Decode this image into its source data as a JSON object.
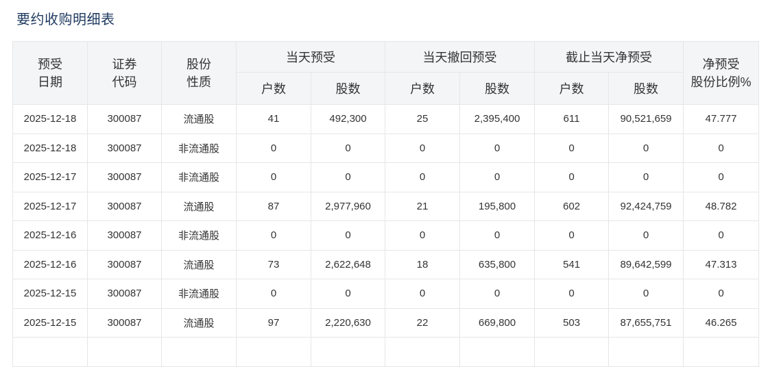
{
  "page": {
    "title": "要约收购明细表"
  },
  "table": {
    "headers": {
      "date": "预受\n日期",
      "code": "证券\n代码",
      "nature": "股份\n性质",
      "group_today": "当天预受",
      "group_withdraw": "当天撤回预受",
      "group_net": "截止当天净预受",
      "ratio": "净预受\n股份比例%",
      "households": "户数",
      "shares": "股数"
    },
    "rows": [
      {
        "date": "2025-12-18",
        "code": "300087",
        "nature": "流通股",
        "today_hh": "41",
        "today_shares": "492,300",
        "wd_hh": "25",
        "wd_shares": "2,395,400",
        "net_hh": "611",
        "net_shares": "90,521,659",
        "ratio": "47.777"
      },
      {
        "date": "2025-12-18",
        "code": "300087",
        "nature": "非流通股",
        "today_hh": "0",
        "today_shares": "0",
        "wd_hh": "0",
        "wd_shares": "0",
        "net_hh": "0",
        "net_shares": "0",
        "ratio": "0"
      },
      {
        "date": "2025-12-17",
        "code": "300087",
        "nature": "非流通股",
        "today_hh": "0",
        "today_shares": "0",
        "wd_hh": "0",
        "wd_shares": "0",
        "net_hh": "0",
        "net_shares": "0",
        "ratio": "0"
      },
      {
        "date": "2025-12-17",
        "code": "300087",
        "nature": "流通股",
        "today_hh": "87",
        "today_shares": "2,977,960",
        "wd_hh": "21",
        "wd_shares": "195,800",
        "net_hh": "602",
        "net_shares": "92,424,759",
        "ratio": "48.782"
      },
      {
        "date": "2025-12-16",
        "code": "300087",
        "nature": "非流通股",
        "today_hh": "0",
        "today_shares": "0",
        "wd_hh": "0",
        "wd_shares": "0",
        "net_hh": "0",
        "net_shares": "0",
        "ratio": "0"
      },
      {
        "date": "2025-12-16",
        "code": "300087",
        "nature": "流通股",
        "today_hh": "73",
        "today_shares": "2,622,648",
        "wd_hh": "18",
        "wd_shares": "635,800",
        "net_hh": "541",
        "net_shares": "89,642,599",
        "ratio": "47.313"
      },
      {
        "date": "2025-12-15",
        "code": "300087",
        "nature": "非流通股",
        "today_hh": "0",
        "today_shares": "0",
        "wd_hh": "0",
        "wd_shares": "0",
        "net_hh": "0",
        "net_shares": "0",
        "ratio": "0"
      },
      {
        "date": "2025-12-15",
        "code": "300087",
        "nature": "流通股",
        "today_hh": "97",
        "today_shares": "2,220,630",
        "wd_hh": "22",
        "wd_shares": "669,800",
        "net_hh": "503",
        "net_shares": "87,655,751",
        "ratio": "46.265"
      },
      {
        "date": "",
        "code": "",
        "nature": "",
        "today_hh": "",
        "today_shares": "",
        "wd_hh": "",
        "wd_shares": "",
        "net_hh": "",
        "net_shares": "",
        "ratio": ""
      }
    ]
  }
}
